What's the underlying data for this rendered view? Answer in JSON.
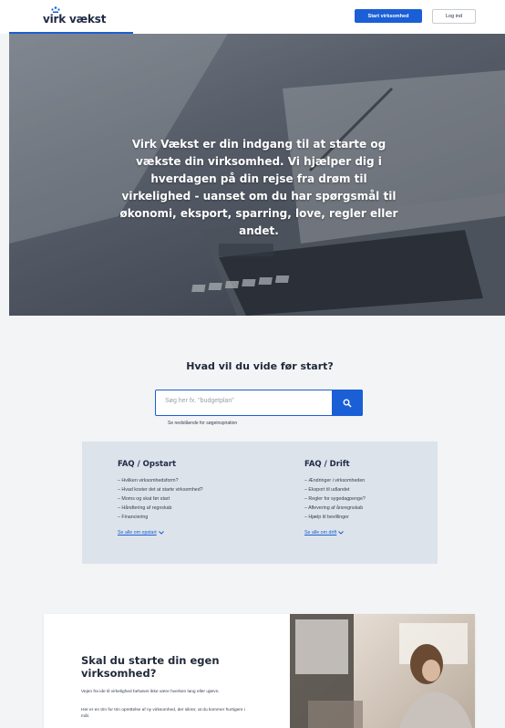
{
  "header": {
    "logo_text": "virk vækst",
    "start_button": "Start virksomhed",
    "login_button": "Log ind"
  },
  "hero": {
    "text": "Virk Vækst er din indgang til at starte og vækste din virksomhed. Vi hjælper dig i hverdagen på din rejse fra drøm til virkelighed - uanset om du har spørgsmål til økonomi, eksport, sparring, love, regler eller andet."
  },
  "search": {
    "title": "Hvad vil du vide før start?",
    "placeholder": "Søg her fx. \"budgetplan\"",
    "hint": "Se nedstående for søgeinspiration"
  },
  "faq": {
    "start": {
      "title": "FAQ / Opstart",
      "items": [
        "– Hvilken virksomhedsform?",
        "– Hvad koster det at starte virksomhed?",
        "– Moms og skat før start",
        "– Håndtering af regnskab",
        "– Financiering"
      ],
      "link": "Se alle om opstart"
    },
    "drift": {
      "title": "FAQ / Drift",
      "items": [
        "– Ændringer i virksomheden",
        "– Eksport til udlandet",
        "– Regler for sygedagpenge?",
        "– Aflevering af årsregnskab",
        "– Hjælp til bevillinger"
      ],
      "link": "Se alle om drift"
    }
  },
  "card": {
    "title": "Skal du starte din egen virksomhed?",
    "paragraph1": "Vejen fra ide til virkelighed behøver ikke være hverken lang eller ujævn.",
    "paragraph2": "Her er en trin for trin oprettelse af ny virksomhed, der sikrer, at du kommer hurtigere i mål."
  },
  "colors": {
    "accent": "#1b5fd6",
    "faq_bg": "#dde3ea",
    "page_bg": "#f3f4f6"
  }
}
